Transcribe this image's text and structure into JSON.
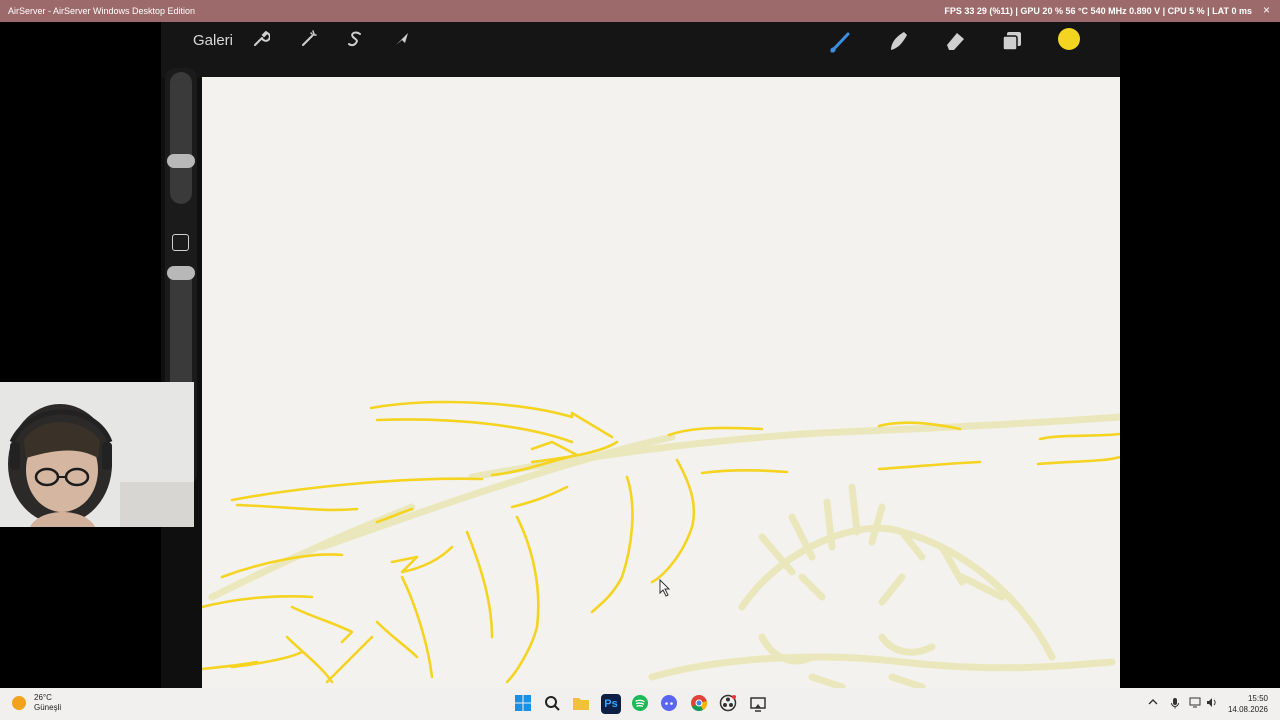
{
  "titlebar": {
    "title": "AirServer - AirServer Windows Desktop Edition",
    "perf": "FPS  33   29 (%11)  |  GPU 20 %  56 °C  540 MHz  0.890 V  |  CPU  5 %  |  LAT  0 ms",
    "close": "×"
  },
  "procreate": {
    "gallery_label": "Galeri",
    "icons": {
      "actions": "wrench-icon",
      "adjustments": "magic-wand-icon",
      "selection": "selection-s-icon",
      "transform": "arrow-cursor-icon",
      "brush": "brush-icon",
      "smudge": "smudge-icon",
      "eraser": "eraser-icon",
      "layers": "layers-icon"
    },
    "active_color": "#f5d321"
  },
  "canvas": {
    "background": "#f3f2ee",
    "stroke_color": "#f5d321",
    "sketch_color": "#ece8b8"
  },
  "taskbar": {
    "weather_temp": "26°C",
    "weather_desc": "Güneşli",
    "apps": [
      "start-icon",
      "search-icon",
      "file-explorer-icon",
      "photoshop-icon",
      "spotify-icon",
      "discord-icon",
      "chrome-icon",
      "obs-icon",
      "airserver-icon"
    ],
    "photoshop_label": "Ps",
    "time": "15:50",
    "date": "14.08.2026"
  }
}
